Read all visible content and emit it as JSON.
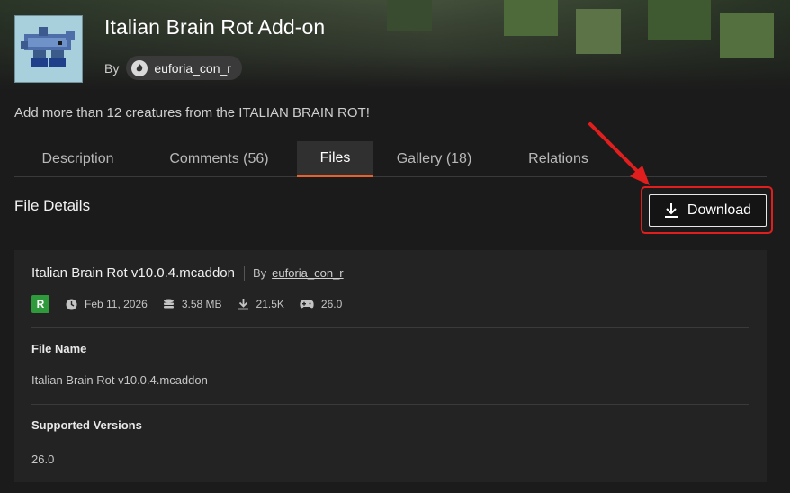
{
  "header": {
    "title": "Italian Brain Rot Add-on",
    "by_label": "By",
    "author": "euforia_con_r"
  },
  "summary": "Add more than 12 creatures from the ITALIAN BRAIN ROT!",
  "tabs": [
    {
      "label": "Description",
      "active": false
    },
    {
      "label": "Comments (56)",
      "active": false
    },
    {
      "label": "Files",
      "active": true
    },
    {
      "label": "Gallery (18)",
      "active": false
    },
    {
      "label": "Relations",
      "active": false
    }
  ],
  "section_title": "File Details",
  "download_label": "Download",
  "file": {
    "title": "Italian Brain Rot v10.0.4.mcaddon",
    "by_label": "By",
    "author": "euforia_con_r",
    "release_badge": "R",
    "date": "Feb 11, 2026",
    "size": "3.58 MB",
    "downloads": "21.5K",
    "game_version": "26.0",
    "file_name_label": "File Name",
    "file_name_value": "Italian Brain Rot v10.0.4.mcaddon",
    "supported_versions_label": "Supported Versions",
    "supported_versions_value": "26.0"
  },
  "colors": {
    "accent_tab": "#e8602c",
    "highlight": "#e01e1e",
    "release_badge": "#2e9a3c"
  }
}
